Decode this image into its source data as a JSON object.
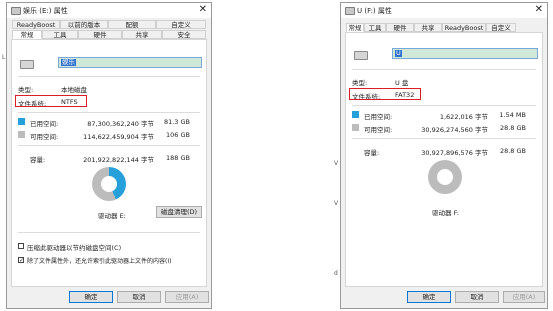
{
  "left": {
    "title": "娱乐 (E:) 属性",
    "tabs_top": [
      "ReadyBoost",
      "以前的版本",
      "配额",
      "自定义"
    ],
    "tabs_bottom": [
      "常规",
      "工具",
      "硬件",
      "共享",
      "安全"
    ],
    "name_value": "娱乐",
    "type_label": "类型:",
    "type_value": "本地磁盘",
    "fs_label": "文件系统:",
    "fs_value": "NTFS",
    "used_label": "已用空间:",
    "used_bytes": "87,300,362,240 字节",
    "used_size": "81.3 GB",
    "free_label": "可用空间:",
    "free_bytes": "114,622,459,904 字节",
    "free_size": "106 GB",
    "cap_label": "容量:",
    "cap_bytes": "201,922,822,144 字节",
    "cap_size": "188 GB",
    "used_fraction": 0.432,
    "drive_label": "驱动器 E:",
    "cleanup_button": "磁盘清理(D)",
    "compress_label": "压缩此驱动器以节约磁盘空间(C)",
    "index_label": "除了文件属性外，还允许索引此驱动器上文件的内容(I)",
    "ok": "确定",
    "cancel": "取消",
    "apply": "应用(A)"
  },
  "right": {
    "title": "U (F:) 属性",
    "tabs": [
      "常规",
      "工具",
      "硬件",
      "共享",
      "ReadyBoost",
      "自定义"
    ],
    "name_value": "U",
    "type_label": "类型:",
    "type_value": "U 盘",
    "fs_label": "文件系统:",
    "fs_value": "FAT32",
    "used_label": "已用空间:",
    "used_bytes": "1,622,016 字节",
    "used_size": "1.54 MB",
    "free_label": "可用空间:",
    "free_bytes": "30,926,274,560 字节",
    "free_size": "28.8 GB",
    "cap_label": "容量:",
    "cap_bytes": "30,927,896,576 字节",
    "cap_size": "28.8 GB",
    "used_fraction": 0.0001,
    "drive_label": "驱动器 F:",
    "ok": "确定",
    "cancel": "取消",
    "apply": "应用(A)"
  },
  "colors": {
    "used": "#26a0da",
    "free": "#bcbcbc",
    "highlight": "#d81f26"
  }
}
